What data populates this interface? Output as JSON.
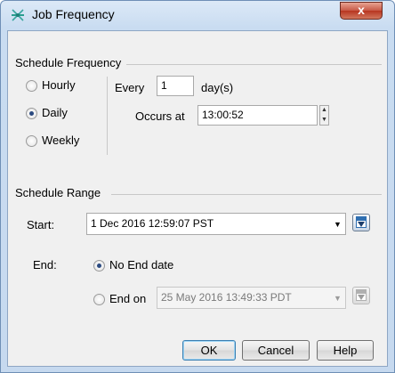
{
  "window": {
    "title": "Job Frequency",
    "close_label": "x"
  },
  "schedule_frequency": {
    "label": "Schedule Frequency",
    "options": [
      "Hourly",
      "Daily",
      "Weekly"
    ],
    "selected": "Daily",
    "every_label": "Every",
    "every_value": "1",
    "every_unit": "day(s)",
    "occurs_at_label": "Occurs at",
    "occurs_at_value": "13:00:52"
  },
  "schedule_range": {
    "label": "Schedule Range",
    "start_label": "Start:",
    "start_value": "1 Dec 2016 12:59:07 PST",
    "end_label": "End:",
    "no_end_label": "No End date",
    "end_on_label": "End on",
    "end_on_value": "25 May 2016 13:49:33 PDT",
    "end_selected": "No End date"
  },
  "buttons": {
    "ok": "OK",
    "cancel": "Cancel",
    "help": "Help"
  },
  "colors": {
    "title_bar": "#c9dcf1",
    "close_button": "#c75845",
    "dialog_body": "#f0f0f0"
  }
}
